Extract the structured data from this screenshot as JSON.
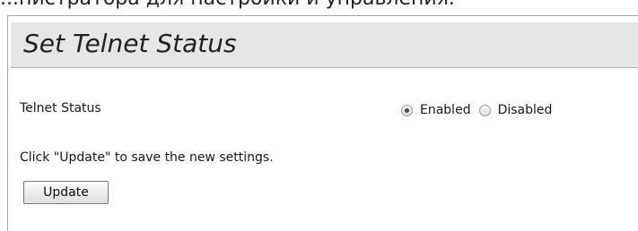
{
  "header_snippet": "...нистратора для настройки и управления.",
  "panel": {
    "title": "Set Telnet Status"
  },
  "telnet": {
    "label": "Telnet Status",
    "options": [
      {
        "label": "Enabled",
        "selected": true
      },
      {
        "label": "Disabled",
        "selected": false
      }
    ]
  },
  "hint": "Click \"Update\" to save the new settings.",
  "update_button": "Update"
}
